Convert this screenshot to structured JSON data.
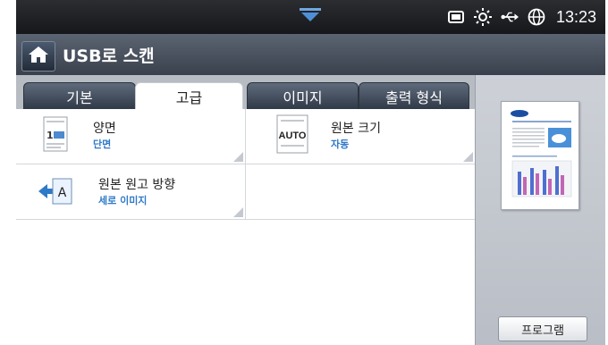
{
  "status_bar": {
    "time": "13:23",
    "icons": [
      "toner-icon",
      "brightness-icon",
      "usb-icon",
      "globe-icon"
    ]
  },
  "header": {
    "home_icon": "home-icon",
    "title": "USB로 스캔"
  },
  "tabs": [
    {
      "label": "기본",
      "active": false
    },
    {
      "label": "고급",
      "active": true
    },
    {
      "label": "이미지",
      "active": false
    },
    {
      "label": "출력 형식",
      "active": false
    }
  ],
  "options": {
    "duplex": {
      "label": "양면",
      "value": "단면",
      "icon": "duplex-page-icon"
    },
    "original_size": {
      "label": "원본 크기",
      "value": "자동",
      "icon": "auto-size-icon",
      "icon_text": "AUTO"
    },
    "orientation": {
      "label": "원본 원고 방향",
      "value": "세로 이미지",
      "icon": "orientation-arrow-icon",
      "icon_text": "A"
    }
  },
  "sidebar": {
    "preview_icon": "document-preview-icon",
    "program_button": "프로그램"
  },
  "colors": {
    "accent_value": "#2e79c8",
    "statusbar": "#1f2024",
    "titlebar": "#4a525f"
  }
}
